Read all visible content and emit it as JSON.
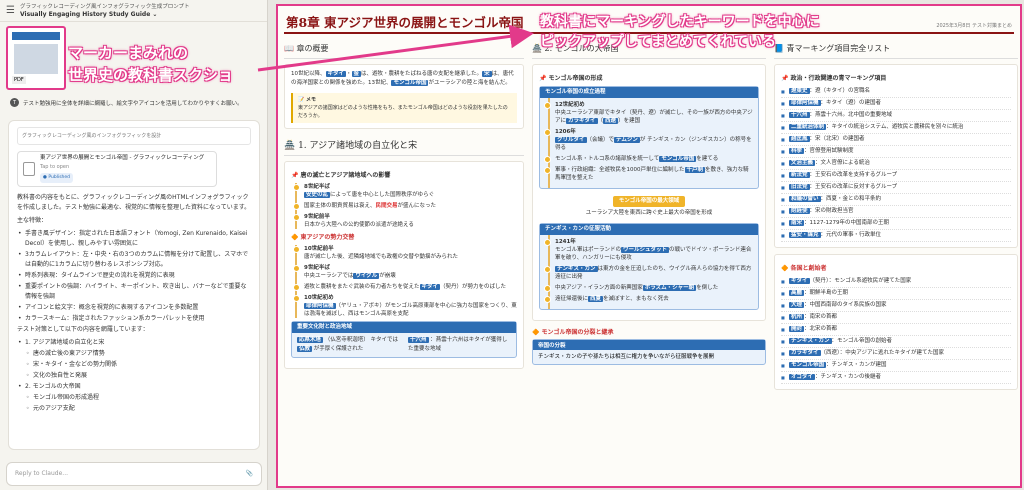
{
  "chat": {
    "breadcrumb": "グラフィックレコーディング風インフォグラフィック生成プロンプト",
    "title": "Visually Engaging History Study Guide ⌄",
    "thumb_badge": "PDF",
    "user_avatar": "T",
    "user_msg": "テスト勉強用に全体を詳細に網羅し、絵文字やアイコンを活用してわかりやすくお願い。",
    "prompt_preview": "グラフィックレコーディング風のインフォグラフィックを設計",
    "artifact_title": "東アジア世界の展開とモンゴル帝国 - グラフィックレコーディング",
    "artifact_sub": "Tap to open",
    "artifact_status": "● Published",
    "intro": "教科書の内容をもとに、グラフィックレコーディング風のHTMLインフォグラフィックを作成しました。テスト勉強に最適な、視覚的に情報を整理した資料になっています。",
    "features_title": "主な特徴：",
    "features": [
      "手書き風デザイン：指定された日本語フォント（Yomogi, Zen Kurenaido, Kaisei Decol）を使用し、親しみやすい雰囲気に",
      "3カラムレイアウト：左・中央・右の3つのカラムに情報を分けて配置し、スマホでは自動的に1カラムに切り替わるレスポンシブ対応。",
      "時系列表現：タイムラインで歴史の流れを視覚的に表現",
      "重要ポイントの強調：ハイライト、キーポイント、吹き出し、バナーなどで重要な情報を強調",
      "アイコンと絵文字：概念を視覚的に表現するアイコンを多数配置",
      "カラースキーム：指定されたファッション系カラーパレットを使用"
    ],
    "test_title": "テスト対策として以下の内容を網羅しています：",
    "outline": [
      {
        "t": "1. アジア諸地域の自立化と宋",
        "sub": false
      },
      {
        "t": "唐の滅亡後の東アジア情勢",
        "sub": true
      },
      {
        "t": "宋・キタイ・金などの勢力関係",
        "sub": true
      },
      {
        "t": "文化の独自性と発展",
        "sub": true
      },
      {
        "t": "2. モンゴルの大帝国",
        "sub": false
      },
      {
        "t": "モンゴル帝国の形成過程",
        "sub": true
      },
      {
        "t": "元のアジア支配",
        "sub": true
      }
    ],
    "composer_placeholder": "Reply to Claude...",
    "annotation": [
      "マーカーまみれの",
      "世界史の教科書スクショ"
    ]
  },
  "doc": {
    "chapter": "第8章 東アジア世界の展開とモンゴル帝国",
    "meta": "2025年3月8日 テスト対策まとめ",
    "annotation": [
      "教科書にマーキングしたキーワードを中心に",
      "ピックアップしてまとめてくれている"
    ],
    "col1": {
      "overview_h": "📖 章の概要",
      "overview": [
        "10世紀以降、",
        "キタイ",
        "・",
        "金",
        "は、遊牧・農耕をたばねる唐の支配を継承した。",
        "宋",
        "は、唐代の海洋国家との関係を強めた。13世紀、",
        "モンゴル帝国",
        "がユーラシアの陸と海を結んだ。"
      ],
      "memo_h": "📝 メモ",
      "memo": "東アジアの諸国家はどのような性格をもち、またモンゴル帝国はどのような役割を果たしたのだろうか。",
      "sec1_h": "🏯 1. アジア諸地域の自立化と宋",
      "sub1": "📌 唐の滅亡とアジア諸地域への影響",
      "tl1": [
        {
          "y": "8世紀半ば",
          "pre": "",
          "kw": "安史の乱",
          "post": "によって唐を中心とした国際秩序がゆらぐ"
        },
        {
          "y": "",
          "pre": "国家主体の朝貢貿易は衰え、",
          "kr": "民間交易",
          "post": "が盛んになった"
        },
        {
          "y": "9世紀前半",
          "pre": "",
          "kw": "",
          "post": "日本から大陸への公的使節の派遣が途絶える"
        }
      ],
      "sub2": "🔶 東アジアの勢力交替",
      "tl2": [
        {
          "y": "10世紀前半",
          "pre": "",
          "kw": "",
          "post": "唐が滅亡した後、近隣諸地域でも政権の交替や動揺がみられた"
        },
        {
          "y": "9世紀半ば",
          "pre": "中央ユーラシアでは",
          "kw": "ウイグル",
          "post": "が崩壊"
        },
        {
          "y": "",
          "pre": "遊牧と農耕をまたぐ武装の有力者たちを従えた",
          "kw": "キタイ",
          "post": "（契丹）が勢力をのばした"
        },
        {
          "y": "10世紀初め",
          "pre": "",
          "kw": "耶律阿保機",
          "post": "（ヤリュ・アボキ）がモンゴル高原東部を中心に強力な国家をつくり、東は渤海を滅ぼし、西はモンゴル高原を支配"
        }
      ],
      "box_h": "重要文化財と政治地域",
      "box_l": [
        "応県木塔",
        "（仏宮寺釈迦塔）",
        "キタイでは",
        "仏教",
        "が手厚く保護された"
      ],
      "box_r": [
        "十六州",
        "：燕雲十六州はキタイが獲得した重要な地域"
      ]
    },
    "col2": {
      "sec_h": "🏯 2. モンゴルの大帝国",
      "sub1": "📌 モンゴル帝国の形成",
      "box1_h": "モンゴル帝国の成立過程",
      "items1": [
        {
          "y": "12世紀初め",
          "pre": "中央ユーラシア東部でキタイ（契丹、遼）が滅亡し、その一族が西方の中央アジアに",
          "kw": "カラキタイ",
          "mid": "（",
          "kw2": "西遼",
          "post": "）を建国"
        },
        {
          "y": "1206年",
          "pre": "",
          "kw": "クリルタイ",
          "mid": "（会議）で",
          "kw2": "テムジン",
          "post": "が チンギス・カン（ジンギスカン）の称号を得る"
        },
        {
          "y": "",
          "pre": "モンゴル系・トルコ系の諸部族を統一して",
          "kw": "モンゴル帝国",
          "mid": "",
          "kw2": "",
          "post": "を建てる"
        },
        {
          "y": "",
          "pre": "軍事・行政組織：全遊牧民を1000戸単位に編制した",
          "kw": "千戸制",
          "mid": "",
          "kw2": "",
          "post": "を敷き、強力な騎馬軍団を整えた"
        }
      ],
      "banner": "モンゴル帝国の最大領域",
      "banner_text": "ユーラシア大陸を東西に跨ぐ史上最大の帝国を形成",
      "box2_h": "チンギス・カンの征服活動",
      "items2": [
        {
          "y": "1241年",
          "pre": "モンゴル軍はポーランドの",
          "kw": "ワールシュタット",
          "post": "の戦いでドイツ・ポーランド連合軍を破り、ハンガリーにも侵攻"
        },
        {
          "y": "",
          "pre": "",
          "kw": "チンギス・カン",
          "post": "は東方の金を圧迫したのち、ウイグル商人らの協力を得て西方遠征に出発"
        },
        {
          "y": "",
          "pre": "中央アジア・イラン方面の新興国家",
          "kw": "ホラズム・シャー朝",
          "post": "を倒した"
        },
        {
          "y": "",
          "pre": "遠征帰還後に",
          "kw": "西夏",
          "post": "を滅ぼすと、まもなく死去"
        }
      ],
      "sec2_h": "🔶 モンゴル帝国の分裂と継承",
      "box3_h": "帝国の分裂",
      "box3_text": "チンギス・カンの子や孫たちは相互に権力を争いながら征服戦争を展開"
    },
    "col3": {
      "sec_h": "📘 青マーキング項目完全リスト",
      "sub1": "📌 政治・行政関連の青マーキング項目",
      "list1": [
        {
          "k": "遼東史",
          "v": "：遼（キタイ）の宮職名"
        },
        {
          "k": "耶律阿保機",
          "v": "：キタイ（遼）の建国者"
        },
        {
          "k": "十六州",
          "v": "：燕雲十六州。北中国の重要地域"
        },
        {
          "k": "二重統治体制",
          "v": "：キタイの統治システム、遊牧民と農耕民を別々に統治"
        },
        {
          "k": "趙匡胤",
          "v": "：宋（北宋）の建国者"
        },
        {
          "k": "科挙",
          "v": "：官僚登用試験制度"
        },
        {
          "k": "文治主義",
          "v": "：文人官僚による統治"
        },
        {
          "k": "新法党",
          "v": "：王安石の改革を支持するグループ"
        },
        {
          "k": "旧法党",
          "v": "：王安石の改革に反対するグループ"
        },
        {
          "k": "和議の誓い",
          "v": "：西夏・金との和平条約"
        },
        {
          "k": "財経使",
          "v": "：宋の財政担当官"
        },
        {
          "k": "南宋",
          "v": "：1127-1279年の中国南部の王朝"
        },
        {
          "k": "猛安・謀克",
          "v": "：元代の軍事・行政単位"
        }
      ],
      "sub2": "🔶 各国と創始者",
      "list2": [
        {
          "k": "キタイ",
          "v": "（契丹）：モンゴル系遊牧民が建てた国家"
        },
        {
          "k": "高麗",
          "v": "：朝鮮半島の王朝"
        },
        {
          "k": "大理",
          "v": "：中国西南部のタイ系民族の国家"
        },
        {
          "k": "杭州",
          "v": "：南宋の首都"
        },
        {
          "k": "開封",
          "v": "：北宋の首都"
        },
        {
          "k": "チンギス・カン",
          "v": "：モンゴル帝国の創始者"
        },
        {
          "k": "カラキタイ",
          "v": "（西遼）：中央アジアに逃れたキタイが建てた国家"
        },
        {
          "k": "モンゴル帝国",
          "v": "：チンギス・カンが建国"
        },
        {
          "k": "オゴダイ",
          "v": "：チンギス・カンの後継者"
        }
      ]
    }
  }
}
